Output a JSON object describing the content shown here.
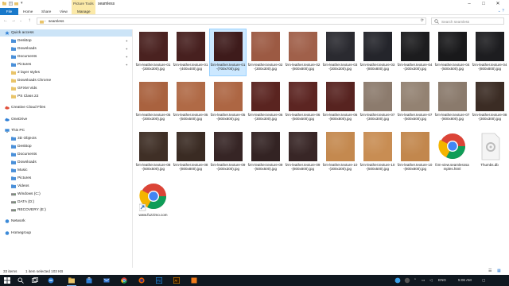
{
  "titlebar": {
    "context_tab": "Picture Tools",
    "title": "seamless"
  },
  "ribbon": {
    "tabs": [
      "File",
      "Home",
      "Share",
      "View",
      "Manage"
    ]
  },
  "address": {
    "path": "seamless",
    "search_placeholder": "Search seamless"
  },
  "nav": {
    "items": [
      {
        "label": "Quick access",
        "icon": "star-icon",
        "indent": 6,
        "selected": true,
        "pinned": false,
        "color": "#2f7fd6"
      },
      {
        "label": "Desktop",
        "icon": "folder-icon",
        "indent": 14,
        "pinned": true,
        "color": "#4a90d9"
      },
      {
        "label": "Downloads",
        "icon": "folder-icon",
        "indent": 14,
        "pinned": true,
        "color": "#4a90d9"
      },
      {
        "label": "Documents",
        "icon": "folder-icon",
        "indent": 14,
        "pinned": true,
        "color": "#4a90d9"
      },
      {
        "label": "Pictures",
        "icon": "folder-icon",
        "indent": 14,
        "pinned": true,
        "color": "#4a90d9"
      },
      {
        "label": "2 layer styles",
        "icon": "folder-icon",
        "indent": 14,
        "pinned": false,
        "color": "#e9c46a"
      },
      {
        "label": "Downloads Chrome",
        "icon": "folder-icon",
        "indent": 14,
        "pinned": false,
        "color": "#e9c46a"
      },
      {
        "label": "GFXM Vids",
        "icon": "folder-icon",
        "indent": 14,
        "pinned": false,
        "color": "#e9c46a"
      },
      {
        "label": "PS Class 22",
        "icon": "folder-icon",
        "indent": 14,
        "pinned": false,
        "color": "#e9c46a"
      },
      {
        "label": "",
        "spacer": true
      },
      {
        "label": "Creative Cloud Files",
        "icon": "cloud-icon",
        "indent": 6,
        "pinned": false,
        "color": "#e04e39"
      },
      {
        "label": "",
        "spacer": true
      },
      {
        "label": "OneDrive",
        "icon": "onedrive-icon",
        "indent": 6,
        "pinned": false,
        "color": "#2f7fd6"
      },
      {
        "label": "",
        "spacer": true
      },
      {
        "label": "This PC",
        "icon": "pc-icon",
        "indent": 6,
        "pinned": false,
        "color": "#3c8ad8"
      },
      {
        "label": "3D Objects",
        "icon": "folder-icon",
        "indent": 14,
        "pinned": false,
        "color": "#4a90d9"
      },
      {
        "label": "Desktop",
        "icon": "folder-icon",
        "indent": 14,
        "pinned": false,
        "color": "#4a90d9"
      },
      {
        "label": "Documents",
        "icon": "folder-icon",
        "indent": 14,
        "pinned": false,
        "color": "#4a90d9"
      },
      {
        "label": "Downloads",
        "icon": "folder-icon",
        "indent": 14,
        "pinned": false,
        "color": "#4a90d9"
      },
      {
        "label": "Music",
        "icon": "folder-icon",
        "indent": 14,
        "pinned": false,
        "color": "#4a90d9"
      },
      {
        "label": "Pictures",
        "icon": "folder-icon",
        "indent": 14,
        "pinned": false,
        "color": "#4a90d9"
      },
      {
        "label": "Videos",
        "icon": "folder-icon",
        "indent": 14,
        "pinned": false,
        "color": "#4a90d9"
      },
      {
        "label": "Windows (C:)",
        "icon": "drive-icon",
        "indent": 14,
        "pinned": false,
        "color": "#888888"
      },
      {
        "label": "DATA (D:)",
        "icon": "drive-icon",
        "indent": 14,
        "pinned": false,
        "color": "#888888"
      },
      {
        "label": "RECOVERY (E:)",
        "icon": "drive-icon",
        "indent": 14,
        "pinned": false,
        "color": "#888888"
      },
      {
        "label": "",
        "spacer": true
      },
      {
        "label": "Network",
        "icon": "network-icon",
        "indent": 6,
        "pinned": false,
        "color": "#3c8ad8"
      },
      {
        "label": "",
        "spacer": true
      },
      {
        "label": "Homegroup",
        "icon": "homegroup-icon",
        "indent": 6,
        "pinned": false,
        "color": "#3c8ad8"
      }
    ]
  },
  "files": [
    {
      "name": "fzm-leather.texture-01-(300x300).jpg",
      "kind": "image",
      "color": "#4a2220"
    },
    {
      "name": "fzm-leather.texture-01-(400x400).jpg",
      "kind": "image",
      "color": "#47201f"
    },
    {
      "name": "fzm-leather.texture-01-(700x700).jpg",
      "kind": "image",
      "color": "#3e1b1b",
      "selected": true
    },
    {
      "name": "fzm-leather.texture-02-(300x300).jpg",
      "kind": "image",
      "color": "#9c5a43"
    },
    {
      "name": "fzm-leather.texture-02-(800x800).jpg",
      "kind": "image",
      "color": "#a0604a"
    },
    {
      "name": "fzm-leather.texture-03-(300x300).jpg",
      "kind": "image",
      "color": "#2a2a30"
    },
    {
      "name": "fzm-leather.texture-03-(800x800).jpg",
      "kind": "image",
      "color": "#24252b"
    },
    {
      "name": "fzm-leather.texture-04-(300x300).jpg",
      "kind": "image",
      "color": "#1c1c1e"
    },
    {
      "name": "fzm-leather.texture-04-(500x500).jpg",
      "kind": "image",
      "color": "#19191b"
    },
    {
      "name": "fzm-leather.texture-04-(800x800).jpg",
      "kind": "image",
      "color": "#1d1d20"
    },
    {
      "name": "fzm-leather.texture-05-(300x300).jpg",
      "kind": "image",
      "color": "#a9623f"
    },
    {
      "name": "fzm-leather.texture-05-(500x500).jpg",
      "kind": "image",
      "color": "#b06a46"
    },
    {
      "name": "fzm-leather.texture-05-(800x800).jpg",
      "kind": "image",
      "color": "#ad6643"
    },
    {
      "name": "fzm-leather.texture-06-(300x300).jpg",
      "kind": "image",
      "color": "#5a2420"
    },
    {
      "name": "fzm-leather.texture-06-(500x500).jpg",
      "kind": "image",
      "color": "#5c2522"
    },
    {
      "name": "fzm-leather.texture-06-(800x800).jpg",
      "kind": "image",
      "color": "#572320"
    },
    {
      "name": "fzm-leather.texture-07-(300x300).jpg",
      "kind": "image",
      "color": "#8c7b6d"
    },
    {
      "name": "fzm-leather.texture-07-(500x500).jpg",
      "kind": "image",
      "color": "#938272"
    },
    {
      "name": "fzm-leather.texture-07-(800x800).jpg",
      "kind": "image",
      "color": "#8a7a6c"
    },
    {
      "name": "fzm-leather.texture-08-(300x300).jpg",
      "kind": "image",
      "color": "#3b2c24"
    },
    {
      "name": "fzm-leather.texture-08-(500x500).jpg",
      "kind": "image",
      "color": "#3f2f26"
    },
    {
      "name": "fzm-leather.texture-08-(800x800).jpg",
      "kind": "image",
      "color": "#3a2b23"
    },
    {
      "name": "fzm-leather.texture-09-(300x300).jpg",
      "kind": "image",
      "color": "#362525"
    },
    {
      "name": "fzm-leather.texture-09-(500x500).jpg",
      "kind": "image",
      "color": "#332323"
    },
    {
      "name": "fzm-leather.texture-09-(800x800).jpg",
      "kind": "image",
      "color": "#382626"
    },
    {
      "name": "fzm-leather.texture-10-(300x300).jpg",
      "kind": "image",
      "color": "#c4894f"
    },
    {
      "name": "fzm-leather.texture-10-(500x500).jpg",
      "kind": "image",
      "color": "#c88d53"
    },
    {
      "name": "fzm-leather.texture-10-(800x800).jpg",
      "kind": "image",
      "color": "#c2874d"
    },
    {
      "name": "fzm-view.seamlesssamples.html",
      "kind": "chrome"
    },
    {
      "name": "Thumbs.db",
      "kind": "db"
    },
    {
      "name": "www.fuzzimo.com",
      "kind": "chrome-shortcut"
    }
  ],
  "status": {
    "count": "33 items",
    "selection": "1 item selected  103 KB"
  },
  "taskbar": {
    "lang": "ENG",
    "time": "5:06 AM"
  },
  "colors": {
    "accent": "#1979ca",
    "selection": "#cce8ff",
    "taskbar": "#101820"
  }
}
